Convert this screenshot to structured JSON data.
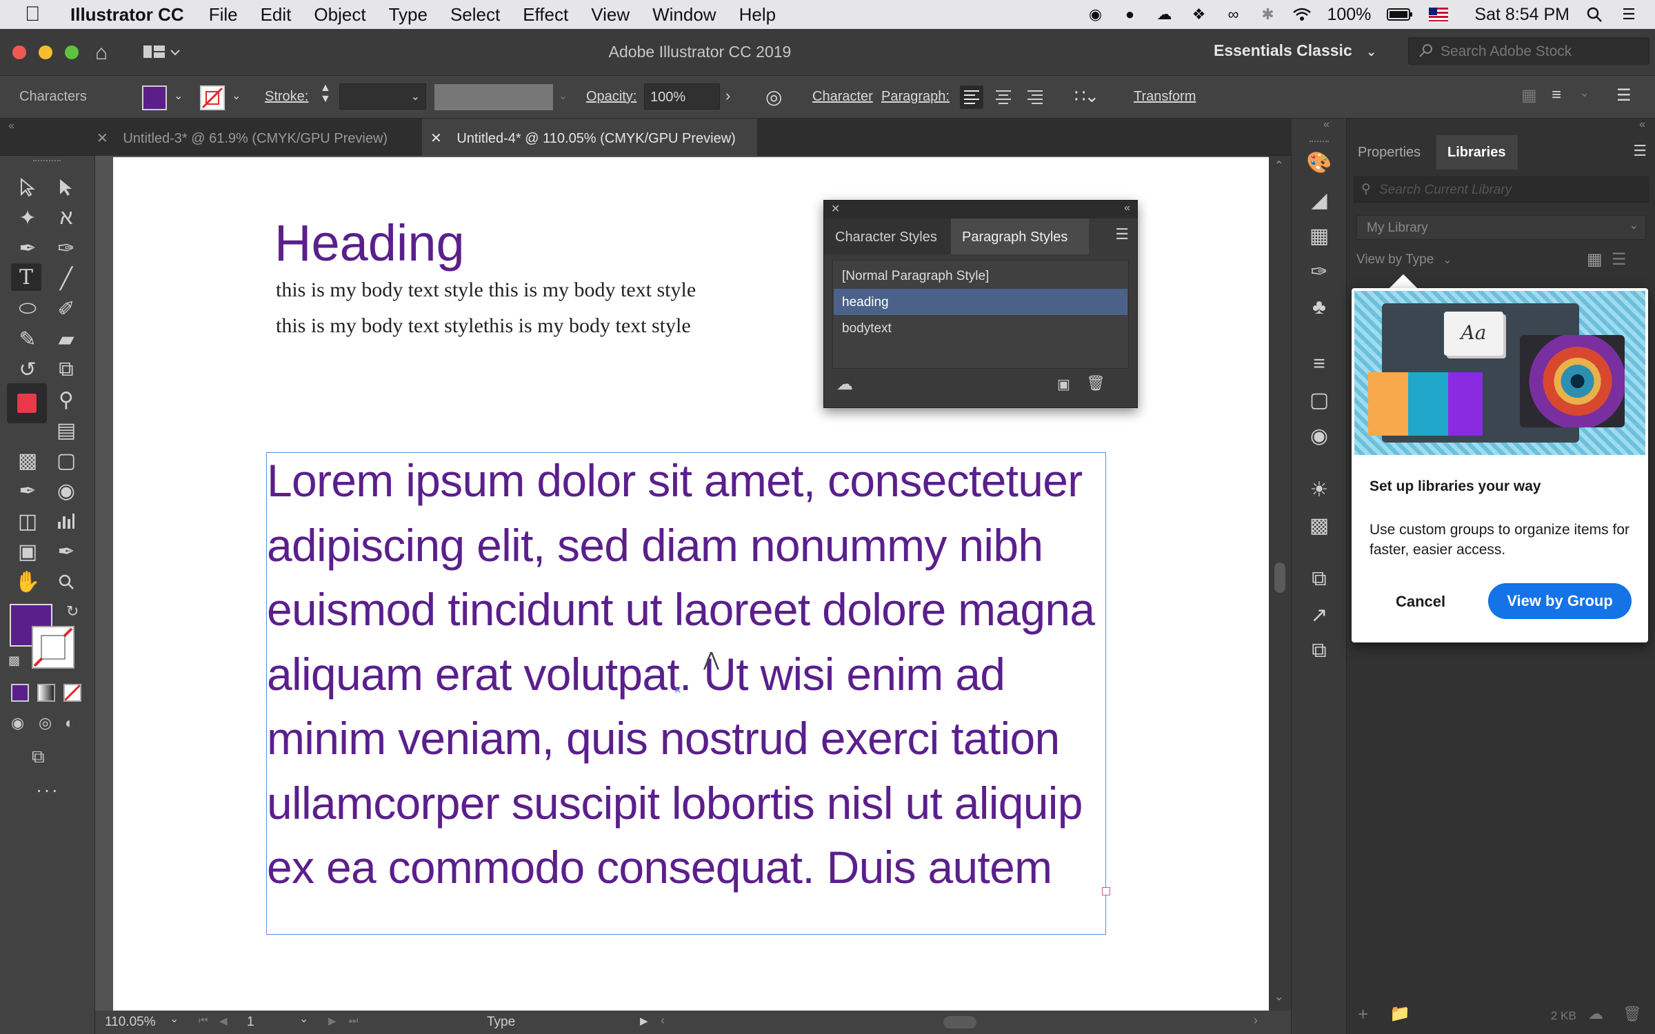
{
  "menubar": {
    "app_name": "Illustrator CC",
    "items": [
      "File",
      "Edit",
      "Object",
      "Type",
      "Select",
      "Effect",
      "View",
      "Window",
      "Help"
    ],
    "battery": "100%",
    "clock": "Sat 8:54 PM"
  },
  "titlebar": {
    "title": "Adobe Illustrator CC 2019",
    "workspace": "Essentials Classic",
    "stock_search_placeholder": "Search Adobe Stock"
  },
  "controlbar": {
    "selection_label": "Characters",
    "fill_color": "#5b1f8c",
    "stroke_label": "Stroke:",
    "opacity_label": "Opacity:",
    "opacity_value": "100%",
    "character_label": "Character",
    "paragraph_label": "Paragraph:",
    "transform_label": "Transform"
  },
  "doc_tabs": [
    {
      "label": "Untitled-3* @ 61.9% (CMYK/GPU Preview)",
      "active": false
    },
    {
      "label": "Untitled-4* @ 110.05% (CMYK/GPU Preview)",
      "active": true
    }
  ],
  "artboard": {
    "heading": "Heading",
    "body_line1": "this is my body text style this is my body text style",
    "body_line2": "this is my body text stylethis is my body text style",
    "lorem_lines": [
      "Lorem ipsum dolor sit amet, consectetuer",
      "adipiscing elit, sed diam nonummy nibh",
      "euismod tincidunt ut laoreet dolore magna",
      "aliquam erat volutpat. Ut wisi enim ad",
      "minim veniam, quis nostrud exerci tation",
      "ullamcorper suscipit lobortis nisl ut aliquip",
      "ex ea commodo consequat. Duis autem"
    ],
    "text_color": "#5b1f8c"
  },
  "paragraph_styles_panel": {
    "tabs": [
      "Character Styles",
      "Paragraph Styles"
    ],
    "rows": [
      "[Normal Paragraph Style]",
      "heading",
      "bodytext"
    ],
    "selected_row": "heading"
  },
  "statusbar": {
    "zoom": "110.05%",
    "artboard_number": "1",
    "tool_name": "Type"
  },
  "libraries_panel": {
    "tabs": [
      "Properties",
      "Libraries"
    ],
    "search_placeholder": "Search Current Library",
    "library_name": "My Library",
    "view_by": "View by Type",
    "footer_size": "2 KB"
  },
  "popup": {
    "thumb_text": "Aa",
    "title": "Set up libraries your way",
    "body": "Use custom groups to organize items for faster, easier access.",
    "cancel_label": "Cancel",
    "primary_label": "View by Group",
    "accent_color": "#1473e6"
  }
}
